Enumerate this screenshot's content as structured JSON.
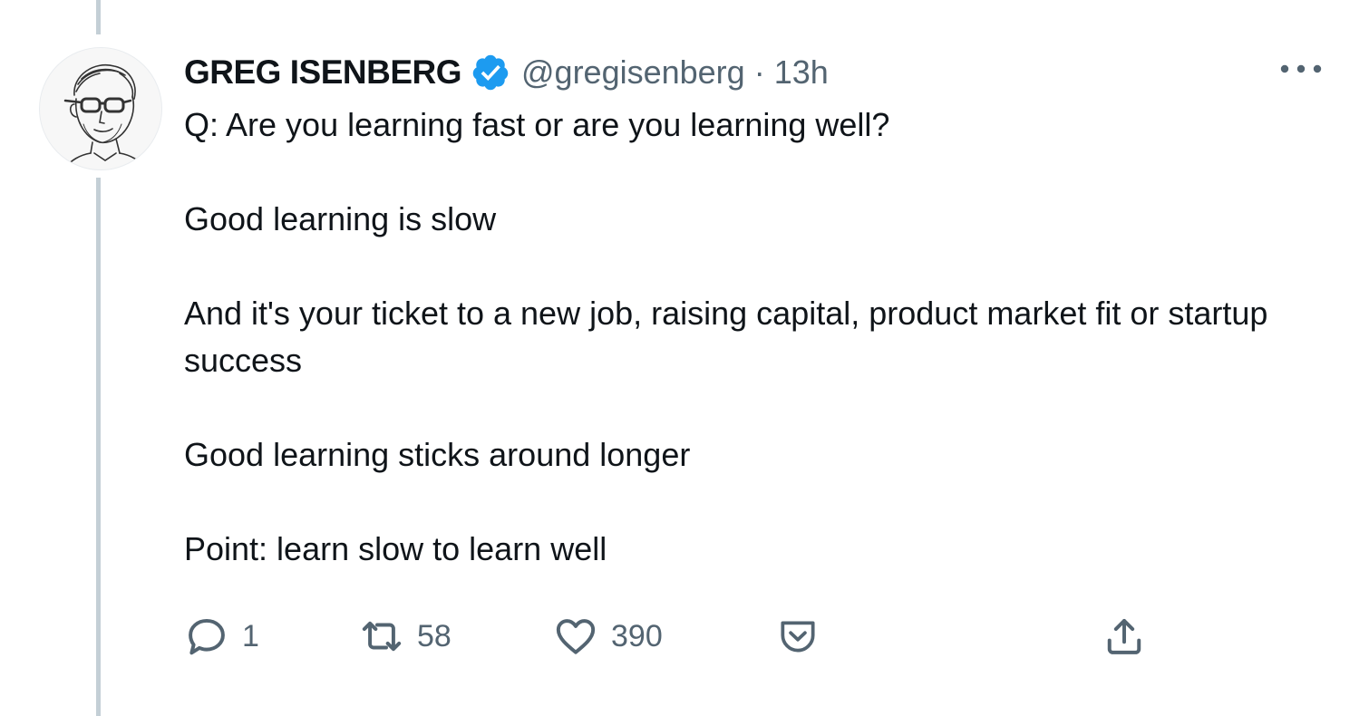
{
  "author": {
    "name": "GREG ISENBERG",
    "handle": "@gregisenberg",
    "separator": "·",
    "time": "13h",
    "verified_icon": "verified-badge-icon",
    "accent_color": "#1d9bf0"
  },
  "tweet": {
    "paragraphs": [
      "Q: Are you learning fast or are you learning well?",
      "Good learning is slow",
      "And it's your ticket to a new job, raising capital, product market fit or startup success",
      "Good learning sticks around longer",
      "Point: learn slow to learn well"
    ]
  },
  "actions": {
    "reply": {
      "icon": "reply-icon",
      "count": "1"
    },
    "retweet": {
      "icon": "retweet-icon",
      "count": "58"
    },
    "like": {
      "icon": "heart-icon",
      "count": "390"
    },
    "pocket": {
      "icon": "pocket-icon"
    },
    "share": {
      "icon": "share-icon"
    }
  },
  "menu": {
    "icon": "more-options-icon"
  },
  "colors": {
    "text": "#0f1419",
    "secondary": "#536471",
    "thread_line": "#c4cfd6"
  }
}
